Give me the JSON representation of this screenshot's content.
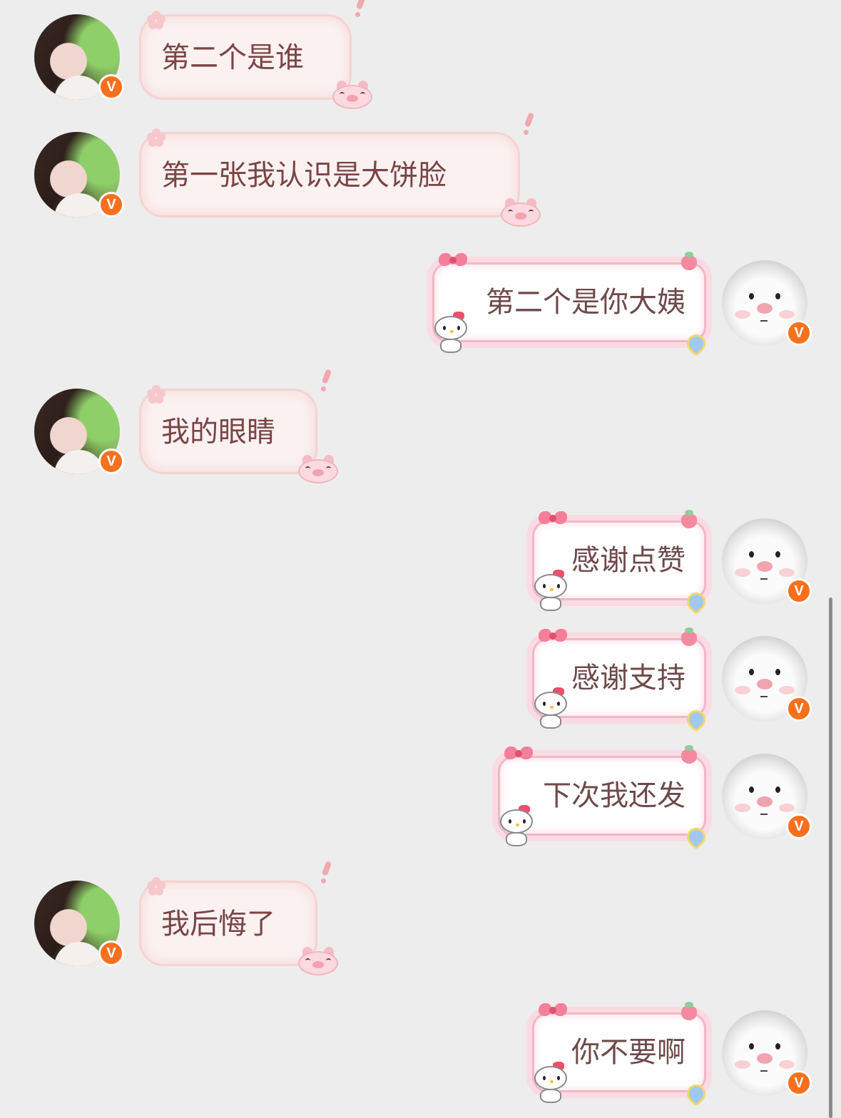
{
  "messages": [
    {
      "side": "left",
      "text": "第二个是谁",
      "badge": "V"
    },
    {
      "side": "left",
      "text": "第一张我认识是大饼脸",
      "badge": "V"
    },
    {
      "side": "right",
      "text": "第二个是你大姨",
      "badge": "V"
    },
    {
      "side": "left",
      "text": "我的眼睛",
      "badge": "V"
    },
    {
      "side": "right",
      "text": "感谢点赞",
      "badge": "V"
    },
    {
      "side": "right",
      "text": "感谢支持",
      "badge": "V"
    },
    {
      "side": "right",
      "text": "下次我还发",
      "badge": "V"
    },
    {
      "side": "left",
      "text": "我后悔了",
      "badge": "V"
    },
    {
      "side": "right",
      "text": "你不要啊",
      "badge": "V"
    }
  ],
  "colors": {
    "background": "#ededed",
    "badge": "#f7701e",
    "left_bubble_text": "#7a4545",
    "right_bubble_text": "#6e4a4a"
  }
}
